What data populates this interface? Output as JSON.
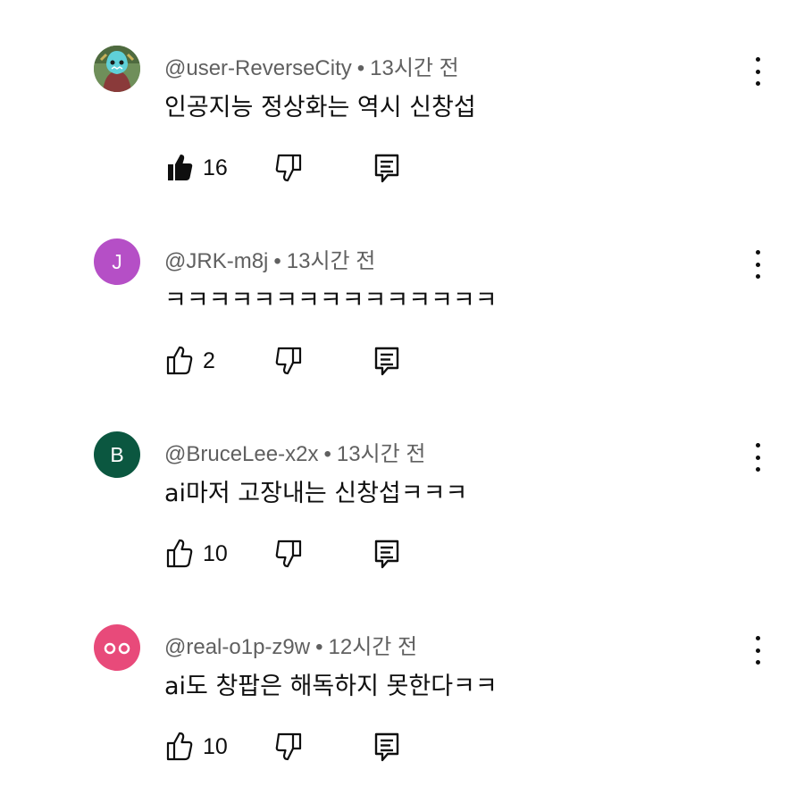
{
  "comments": [
    {
      "author": "@user-ReverseCity",
      "time": "13시간 전",
      "text": "인공지능 정상화는 역시 신창섭",
      "likes": "16",
      "liked": true,
      "avatar": {
        "type": "image",
        "letter": "",
        "color": "#7a9a6a"
      }
    },
    {
      "author": "@JRK-m8j",
      "time": "13시간 전",
      "text": "ㅋㅋㅋㅋㅋㅋㅋㅋㅋㅋㅋㅋㅋㅋㅋ",
      "likes": "2",
      "liked": false,
      "avatar": {
        "type": "letter",
        "letter": "J",
        "color": "#b54fc6"
      }
    },
    {
      "author": "@BruceLee-x2x",
      "time": "13시간 전",
      "text": "ai마저 고장내는 신창섭ㅋㅋㅋ",
      "likes": "10",
      "liked": false,
      "avatar": {
        "type": "letter",
        "letter": "B",
        "color": "#0b5740"
      }
    },
    {
      "author": "@real-o1p-z9w",
      "time": "12시간 전",
      "text": "ai도 창팝은 해독하지 못한다ㅋㅋ",
      "likes": "10",
      "liked": false,
      "avatar": {
        "type": "eyes",
        "letter": "",
        "color": "#e84a7a"
      }
    }
  ],
  "icons": {
    "like": "thumbs-up-icon",
    "dislike": "thumbs-down-icon",
    "reply": "reply-comment-icon",
    "more": "more-vertical-icon"
  }
}
